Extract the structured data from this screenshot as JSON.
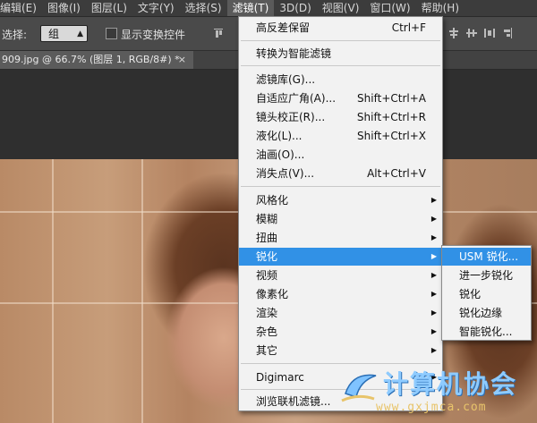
{
  "menubar": {
    "items": [
      "编辑(E)",
      "图像(I)",
      "图层(L)",
      "文字(Y)",
      "选择(S)",
      "滤镜(T)",
      "3D(D)",
      "视图(V)",
      "窗口(W)",
      "帮助(H)"
    ]
  },
  "options": {
    "auto_select_label": "选择:",
    "auto_select_value": "组",
    "show_transform_label": "显示变换控件"
  },
  "document_tab": {
    "title": "909.jpg @ 66.7% (图层 1, RGB/8#) *",
    "close": "×"
  },
  "filter_menu": {
    "items": [
      {
        "label": "高反差保留",
        "shortcut": "Ctrl+F"
      },
      {
        "label": "转换为智能滤镜",
        "shortcut": ""
      },
      {
        "label": "滤镜库(G)...",
        "shortcut": ""
      },
      {
        "label": "自适应广角(A)...",
        "shortcut": "Shift+Ctrl+A"
      },
      {
        "label": "镜头校正(R)...",
        "shortcut": "Shift+Ctrl+R"
      },
      {
        "label": "液化(L)...",
        "shortcut": "Shift+Ctrl+X"
      },
      {
        "label": "油画(O)...",
        "shortcut": ""
      },
      {
        "label": "消失点(V)...",
        "shortcut": "Alt+Ctrl+V"
      },
      {
        "label": "风格化",
        "shortcut": ""
      },
      {
        "label": "模糊",
        "shortcut": ""
      },
      {
        "label": "扭曲",
        "shortcut": ""
      },
      {
        "label": "锐化",
        "shortcut": ""
      },
      {
        "label": "视频",
        "shortcut": ""
      },
      {
        "label": "像素化",
        "shortcut": ""
      },
      {
        "label": "渲染",
        "shortcut": ""
      },
      {
        "label": "杂色",
        "shortcut": ""
      },
      {
        "label": "其它",
        "shortcut": ""
      },
      {
        "label": "Digimarc",
        "shortcut": ""
      },
      {
        "label": "浏览联机滤镜...",
        "shortcut": ""
      }
    ],
    "highlighted": "锐化"
  },
  "sharpen_submenu": {
    "items": [
      "USM 锐化...",
      "进一步锐化",
      "锐化",
      "锐化边缘",
      "智能锐化..."
    ],
    "highlighted": "USM 锐化..."
  },
  "watermark": {
    "name": "计算机协会",
    "url": "www.gxjmca.com"
  },
  "colors": {
    "highlight": "#3191e6",
    "menu_bg": "#f2f2f2",
    "ui_dark": "#3c3c3c"
  }
}
